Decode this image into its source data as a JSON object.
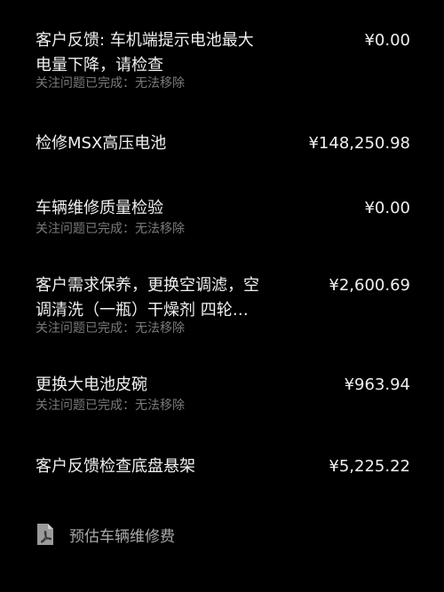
{
  "items": [
    {
      "title": "客户反馈: 车机端提示电池最大电量下降，请检查",
      "price": "¥0.00",
      "subtitle": "关注问题已完成：无法移除"
    },
    {
      "title": "检修MSX高压电池",
      "price": "¥148,250.98"
    },
    {
      "title": "车辆维修质量检验",
      "price": "¥0.00",
      "subtitle": "关注问题已完成：无法移除"
    },
    {
      "title": "客户需求保养，更换空调滤，空调清洗（一瓶）干燥剂 四轮…",
      "price": "¥2,600.69",
      "subtitle": "关注问题已完成：无法移除"
    },
    {
      "title": "更换大电池皮碗",
      "price": "¥963.94",
      "subtitle": "关注问题已完成：无法移除"
    },
    {
      "title": "客户反馈检查底盘悬架",
      "price": "¥5,225.22"
    }
  ],
  "footer": {
    "icon": "pdf-document-icon",
    "label": "预估车辆维修费"
  }
}
